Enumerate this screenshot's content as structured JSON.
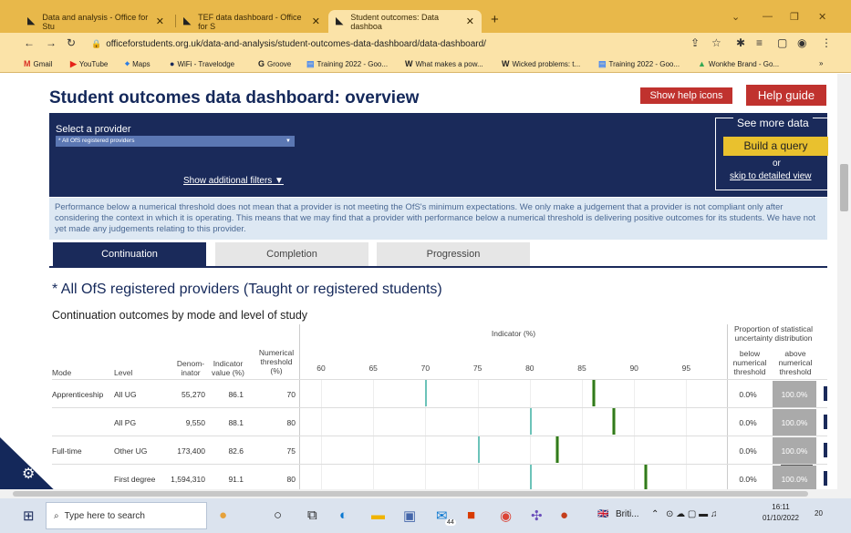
{
  "browser": {
    "tabs": [
      {
        "title": "Data and analysis - Office for Stu",
        "active": false
      },
      {
        "title": "TEF data dashboard - Office for S",
        "active": false
      },
      {
        "title": "Student outcomes: Data dashboa",
        "active": true
      }
    ],
    "new_tab": "+",
    "url": "officeforstudents.org.uk/data-and-analysis/student-outcomes-data-dashboard/data-dashboard/",
    "bookmarks": [
      "Gmail",
      "YouTube",
      "Maps",
      "WiFi - Travelodge",
      "Groove",
      "Training 2022 - Goo...",
      "What makes a pow...",
      "Wicked problems: t...",
      "Training 2022 - Goo...",
      "Wonkhe Brand - Go..."
    ],
    "bookmarks_more": "»"
  },
  "page": {
    "title": "Student outcomes data dashboard: overview",
    "show_help_icons": "Show help icons",
    "help_guide": "Help guide",
    "select_label": "Select a provider",
    "provider_selected": "* All OfS registered providers",
    "show_filters": "Show additional filters ▼",
    "see_more": "See more data",
    "build_query": "Build a query",
    "or": "or",
    "skip_link": "skip to detailed view",
    "notice": "Performance below a numerical threshold does not mean that a provider is not meeting the OfS's minimum expectations. We only make a judgement that a provider is not compliant only after considering the context in which it is operating. This means that we may find that a provider with performance below a numerical threshold is delivering positive outcomes for its students. We have not yet made any judgements relating to this provider.",
    "tabs": [
      "Continuation",
      "Completion",
      "Progression"
    ],
    "active_tab": "Continuation",
    "subtitle": "* All OfS registered providers (Taught or registered students)",
    "table_title": "Continuation outcomes by mode and level of study"
  },
  "table": {
    "headers": {
      "mode": "Mode",
      "level": "Level",
      "denom": "Denom-inator",
      "indicator": "Indicator value (%)",
      "threshold": "Numerical threshold (%)",
      "chart": "Indicator (%)",
      "proportion": "Proportion of statistical uncertainty distribution",
      "below": "below numerical threshold",
      "above": "above numerical threshold"
    },
    "rows": [
      {
        "mode": "Apprenticeship",
        "level": "All UG",
        "denom": "55,270",
        "indicator": "86.1",
        "threshold": "70",
        "below": "0.0%",
        "above": "100.0%"
      },
      {
        "mode": "",
        "level": "All PG",
        "denom": "9,550",
        "indicator": "88.1",
        "threshold": "80",
        "below": "0.0%",
        "above": "100.0%"
      },
      {
        "mode": "Full-time",
        "level": "Other UG",
        "denom": "173,400",
        "indicator": "82.6",
        "threshold": "75",
        "below": "0.0%",
        "above": "100.0%"
      },
      {
        "mode": "",
        "level": "First degree",
        "denom": "1,594,310",
        "indicator": "91.1",
        "threshold": "80",
        "below": "0.0%",
        "above": "100.0%"
      }
    ]
  },
  "chart_data": {
    "type": "scatter",
    "title": "Indicator (%)",
    "xlabel": "Indicator (%)",
    "x_ticks": [
      60,
      65,
      70,
      75,
      80,
      85,
      90,
      95
    ],
    "xlim": [
      57.7,
      98.9
    ],
    "series": [
      {
        "name": "Indicator value (%)",
        "values": [
          86.1,
          88.1,
          82.6,
          91.1
        ]
      },
      {
        "name": "Numerical threshold (%)",
        "values": [
          70,
          80,
          75,
          80
        ]
      }
    ],
    "categories": [
      "Apprenticeship All UG",
      "Apprenticeship All PG",
      "Full-time Other UG",
      "Full-time First degree"
    ],
    "colors": {
      "indicator": "#1e6b10",
      "threshold": "#6cc3b9"
    }
  },
  "taskbar": {
    "search_placeholder": "Type here to search",
    "language": "Briti...",
    "time": "16:11",
    "date": "01/10/2022",
    "notifications": "20",
    "mail_badge": "44"
  },
  "colors": {
    "navy": "#1a2a5a",
    "red": "#c0322e",
    "yellow": "#e9c12e",
    "tab_bar": "#e8b84a"
  }
}
